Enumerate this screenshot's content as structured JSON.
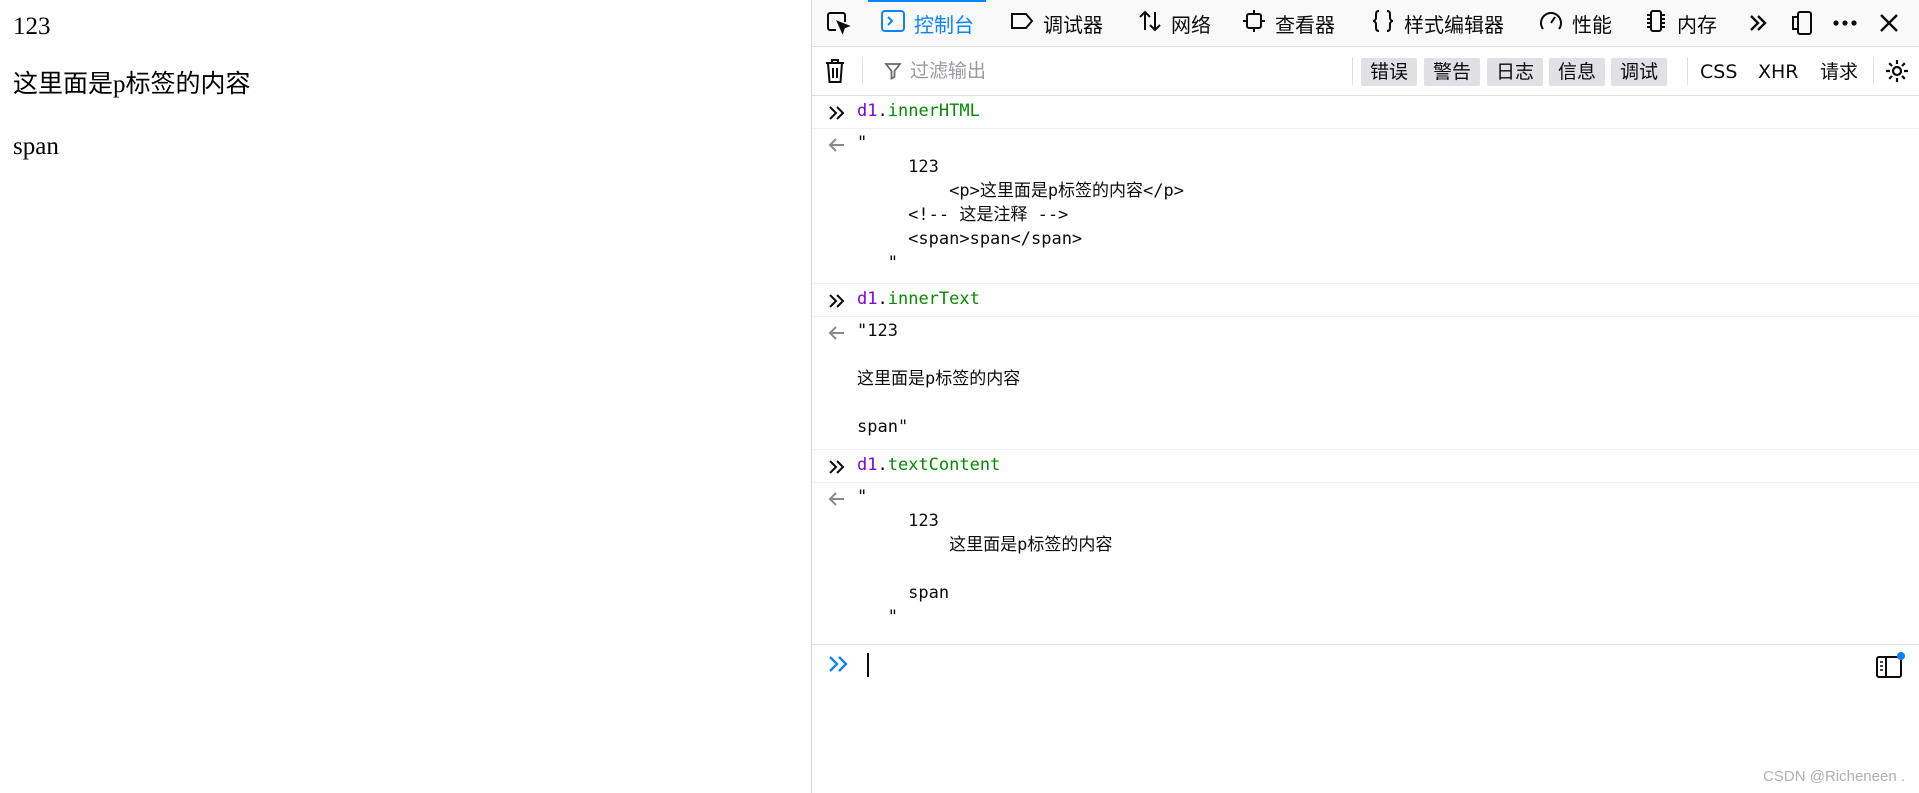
{
  "page": {
    "lines": [
      "123",
      "这里面是p标签的内容",
      "span"
    ]
  },
  "devtools": {
    "tabs": [
      {
        "label": "控制台",
        "icon": "console-icon",
        "active": true
      },
      {
        "label": "调试器",
        "icon": "debugger-icon"
      },
      {
        "label": "网络",
        "icon": "network-icon"
      },
      {
        "label": "查看器",
        "icon": "inspector-icon"
      },
      {
        "label": "样式编辑器",
        "icon": "style-editor-icon"
      },
      {
        "label": "性能",
        "icon": "performance-icon"
      },
      {
        "label": "内存",
        "icon": "memory-icon"
      }
    ],
    "filter_placeholder": "过滤输出",
    "levels": [
      "错误",
      "警告",
      "日志",
      "信息",
      "调试"
    ],
    "request_filters": [
      "CSS",
      "XHR",
      "请求"
    ],
    "accent": "#0a84ff"
  },
  "console": {
    "entries": [
      {
        "input_obj": "d1",
        "input_prop": "innerHTML",
        "result": "\"\n     123\n         <p>这里面是p标签的内容</p>\n     <!-- 这是注释 -->\n     <span>span</span>\n   \""
      },
      {
        "input_obj": "d1",
        "input_prop": "innerText",
        "result": "\"123\n\n这里面是p标签的内容\n\nspan\""
      },
      {
        "input_obj": "d1",
        "input_prop": "textContent",
        "result": "\"\n     123\n         这里面是p标签的内容\n\n     span\n   \""
      }
    ]
  },
  "watermark": "CSDN @Richeneen ."
}
